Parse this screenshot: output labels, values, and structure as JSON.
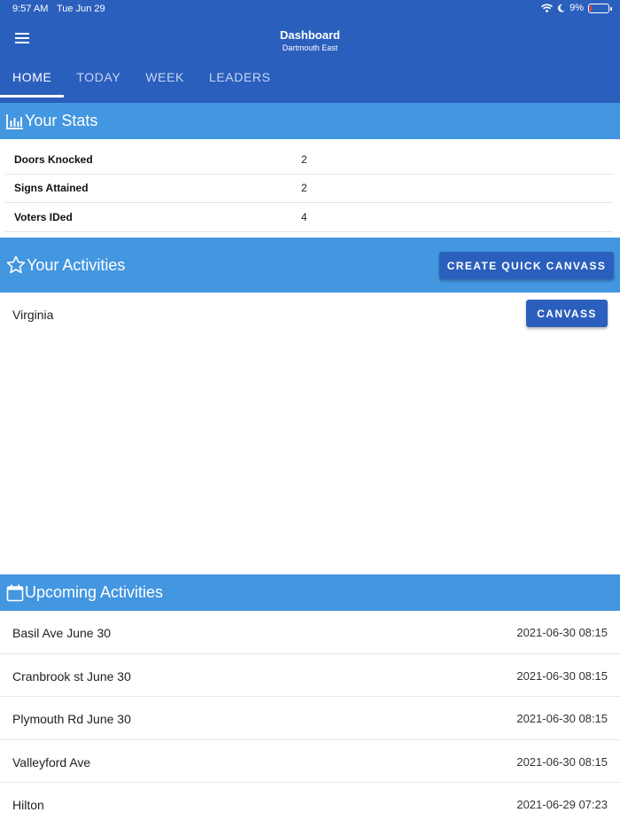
{
  "status_bar": {
    "time": "9:57 AM",
    "date": "Tue Jun 29",
    "battery": "9%",
    "battery_fraction": 0.09
  },
  "header": {
    "title": "Dashboard",
    "subtitle": "Dartmouth East"
  },
  "tabs": [
    {
      "label": "HOME",
      "active": true
    },
    {
      "label": "TODAY",
      "active": false
    },
    {
      "label": "WEEK",
      "active": false
    },
    {
      "label": "LEADERS",
      "active": false
    }
  ],
  "stats": {
    "title": "Your Stats",
    "rows": [
      {
        "label": "Doors Knocked",
        "value": "2"
      },
      {
        "label": "Signs Attained",
        "value": "2"
      },
      {
        "label": "Voters IDed",
        "value": "4"
      }
    ]
  },
  "activities": {
    "title": "Your Activities",
    "create_button": "CREATE QUICK CANVASS",
    "items": [
      {
        "name": "Virginia",
        "action": "CANVASS"
      }
    ]
  },
  "upcoming": {
    "title": "Upcoming Activities",
    "items": [
      {
        "name": "Basil Ave June 30",
        "datetime": "2021-06-30 08:15"
      },
      {
        "name": "Cranbrook st June 30",
        "datetime": "2021-06-30 08:15"
      },
      {
        "name": "Plymouth Rd June 30",
        "datetime": "2021-06-30 08:15"
      },
      {
        "name": "Valleyford Ave",
        "datetime": "2021-06-30 08:15"
      },
      {
        "name": "Hilton",
        "datetime": "2021-06-29 07:23"
      }
    ]
  },
  "colors": {
    "header": "#2b5fbd",
    "section": "#4396e0",
    "battery_low": "#ff3b30"
  }
}
